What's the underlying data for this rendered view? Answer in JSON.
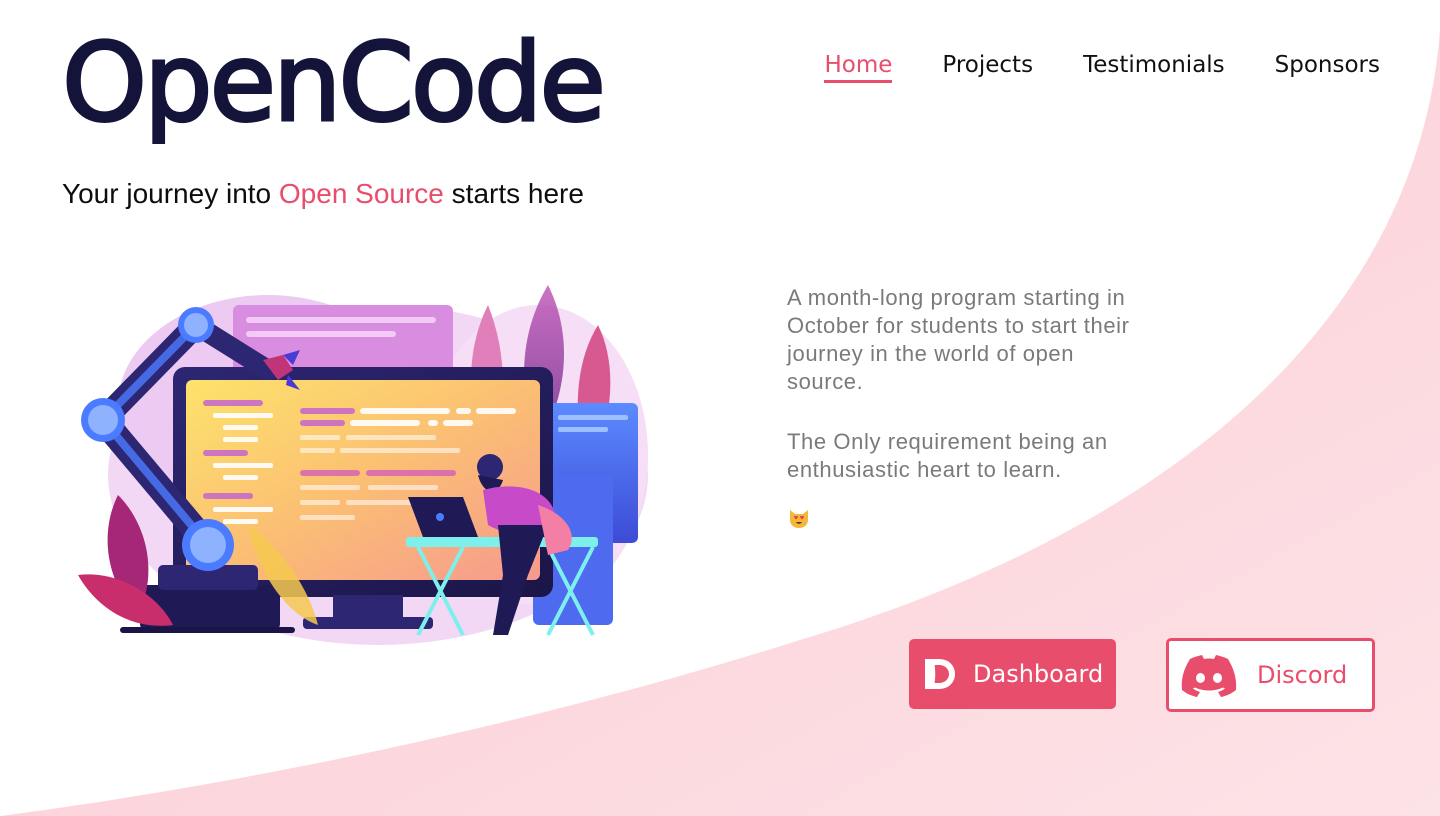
{
  "header": {
    "logo_text": "OpenCode",
    "nav": [
      {
        "label": "Home",
        "active": true
      },
      {
        "label": "Projects",
        "active": false
      },
      {
        "label": "Testimonials",
        "active": false
      },
      {
        "label": "Sponsors",
        "active": false
      }
    ]
  },
  "hero": {
    "tagline_pre": "Your journey into ",
    "tagline_highlight": "Open Source",
    "tagline_post": " starts here",
    "description_1": "A month-long program starting in October for students to start their journey in the world of open source.",
    "description_2": "The Only requirement being an enthusiastic heart to learn.",
    "emoji_icon": "heart-eyes-cat-icon"
  },
  "buttons": {
    "dashboard_label": "Dashboard",
    "discord_label": "Discord"
  },
  "colors": {
    "accent": "#e94d6c",
    "logo": "#14143b",
    "background_curve": "#fcd3d9"
  }
}
